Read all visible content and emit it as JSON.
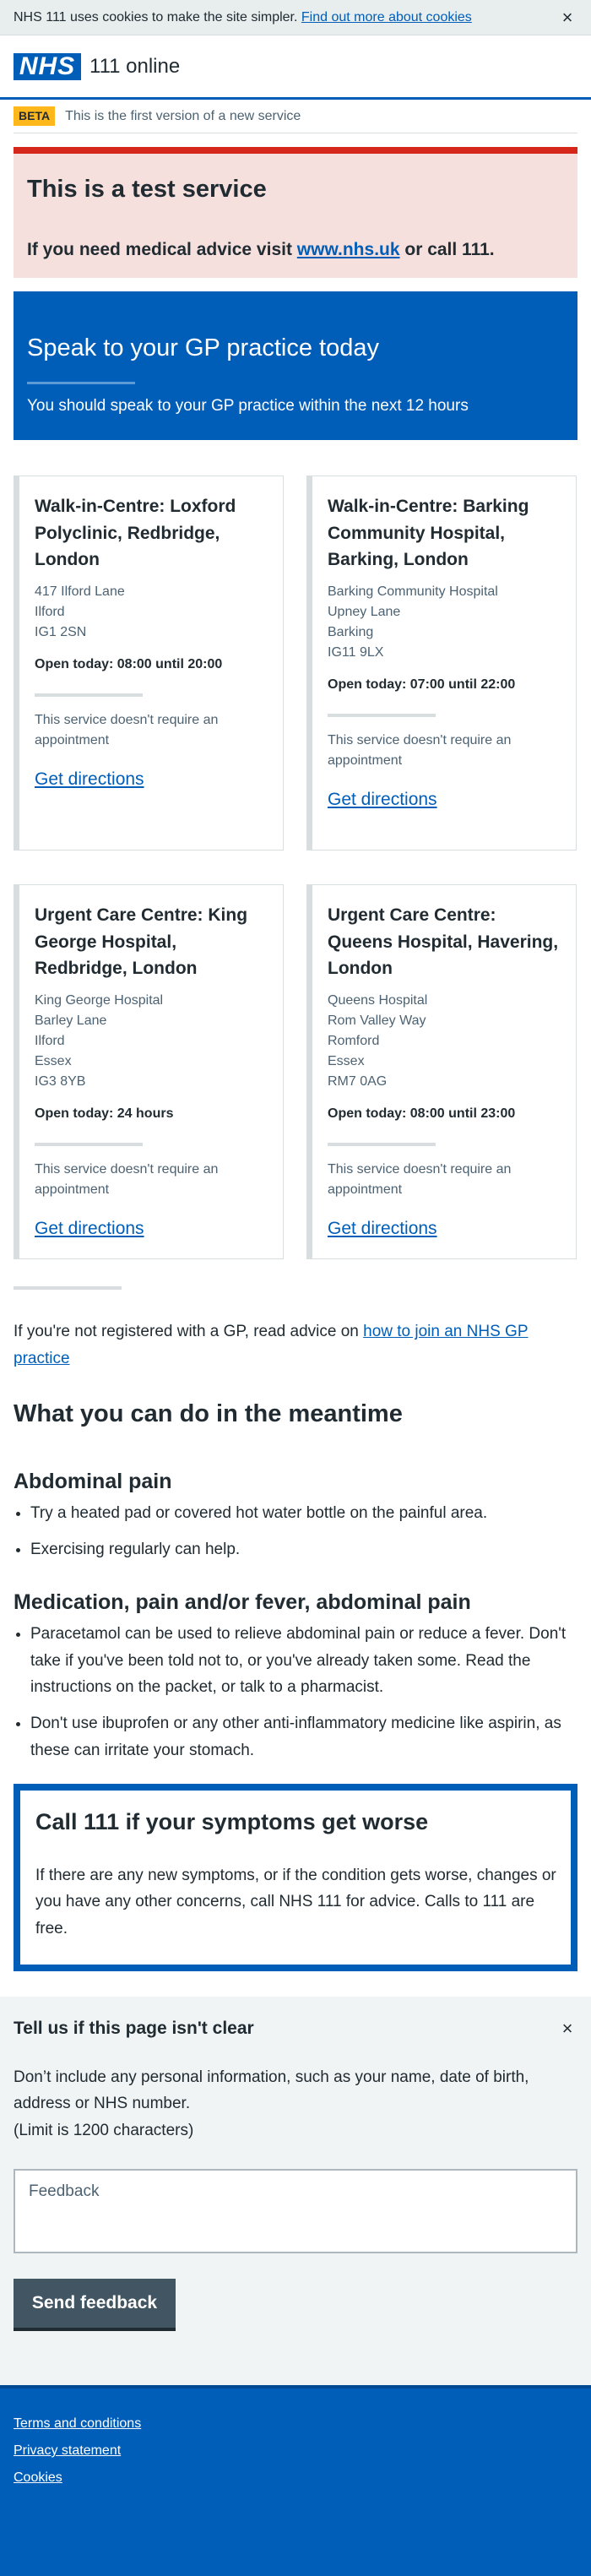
{
  "cookie_banner": {
    "text": "NHS 111 uses cookies to make the site simpler.",
    "link": "Find out more about cookies",
    "close_icon": "×"
  },
  "header": {
    "logo": "NHS",
    "service_name": "111 online"
  },
  "beta": {
    "tag": "BETA",
    "text": "This is the first version of a new service"
  },
  "test_service": {
    "title": "This is a test service",
    "text_before": "If you need medical advice visit ",
    "link": "www.nhs.uk",
    "text_after": " or call 111."
  },
  "hero": {
    "title": "Speak to your GP practice today",
    "subtitle": "You should speak to your GP practice within the next 12 hours"
  },
  "services": [
    {
      "name": "Walk-in-Centre: Loxford Polyclinic, Redbridge, London",
      "address": [
        "417 Ilford Lane",
        "Ilford",
        "IG1 2SN"
      ],
      "hours": "Open today: 08:00 until 20:00",
      "appointment": "This service doesn't require an appointment",
      "directions": "Get directions"
    },
    {
      "name": "Walk-in-Centre: Barking Community Hospital, Barking, London",
      "address": [
        "Barking Community Hospital",
        "Upney Lane",
        "Barking",
        "IG11 9LX"
      ],
      "hours": "Open today: 07:00 until 22:00",
      "appointment": "This service doesn't require an appointment",
      "directions": "Get directions"
    },
    {
      "name": "Urgent Care Centre: King George Hospital, Redbridge, London",
      "address": [
        "King George Hospital",
        "Barley Lane",
        "Ilford",
        "Essex",
        "IG3 8YB"
      ],
      "hours": "Open today: 24 hours",
      "appointment": "This service doesn't require an appointment",
      "directions": "Get directions"
    },
    {
      "name": "Urgent Care Centre: Queens Hospital, Havering, London",
      "address": [
        "Queens Hospital",
        "Rom Valley Way",
        "Romford",
        "Essex",
        "RM7 0AG"
      ],
      "hours": "Open today: 08:00 until 23:00",
      "appointment": "This service doesn't require an appointment",
      "directions": "Get directions"
    }
  ],
  "gp_advice": {
    "text": "If you're not registered with a GP, read advice on ",
    "link": "how to join an NHS GP practice"
  },
  "meantime": {
    "title": "What you can do in the meantime",
    "sections": [
      {
        "heading": "Abdominal pain",
        "items": [
          "Try a heated pad or covered hot water bottle on the painful area.",
          "Exercising regularly can help."
        ]
      },
      {
        "heading": "Medication, pain and/or fever, abdominal pain",
        "items": [
          "Paracetamol can be used to relieve abdominal pain or reduce a fever. Don't take if you've been told not to, or you've already taken some. Read the instructions on the packet, or talk to a pharmacist.",
          "Don't use ibuprofen or any other anti-inflammatory medicine like aspirin, as these can irritate your stomach."
        ]
      }
    ]
  },
  "care_card": {
    "title": "Call 111 if your symptoms get worse",
    "text": "If there are any new symptoms, or if the condition gets worse, changes or you have any other concerns, call NHS 111 for advice. Calls to 111 are free."
  },
  "feedback": {
    "title": "Tell us if this page isn't clear",
    "close_icon": "×",
    "info_1": "Don’t include any personal information, such as your name, date of birth, address or NHS number.",
    "info_2": "(Limit is 1200 characters)",
    "placeholder": "Feedback",
    "button": "Send feedback"
  },
  "footer": {
    "links": [
      "Terms and conditions",
      "Privacy statement",
      "Cookies"
    ]
  },
  "colors": {
    "nhs_blue": "#005eb8",
    "warning_red": "#d5281b",
    "beta_yellow": "#ffb81c",
    "text": "#212b32",
    "secondary_text": "#4c6272",
    "grey_border": "#d8dde0"
  }
}
